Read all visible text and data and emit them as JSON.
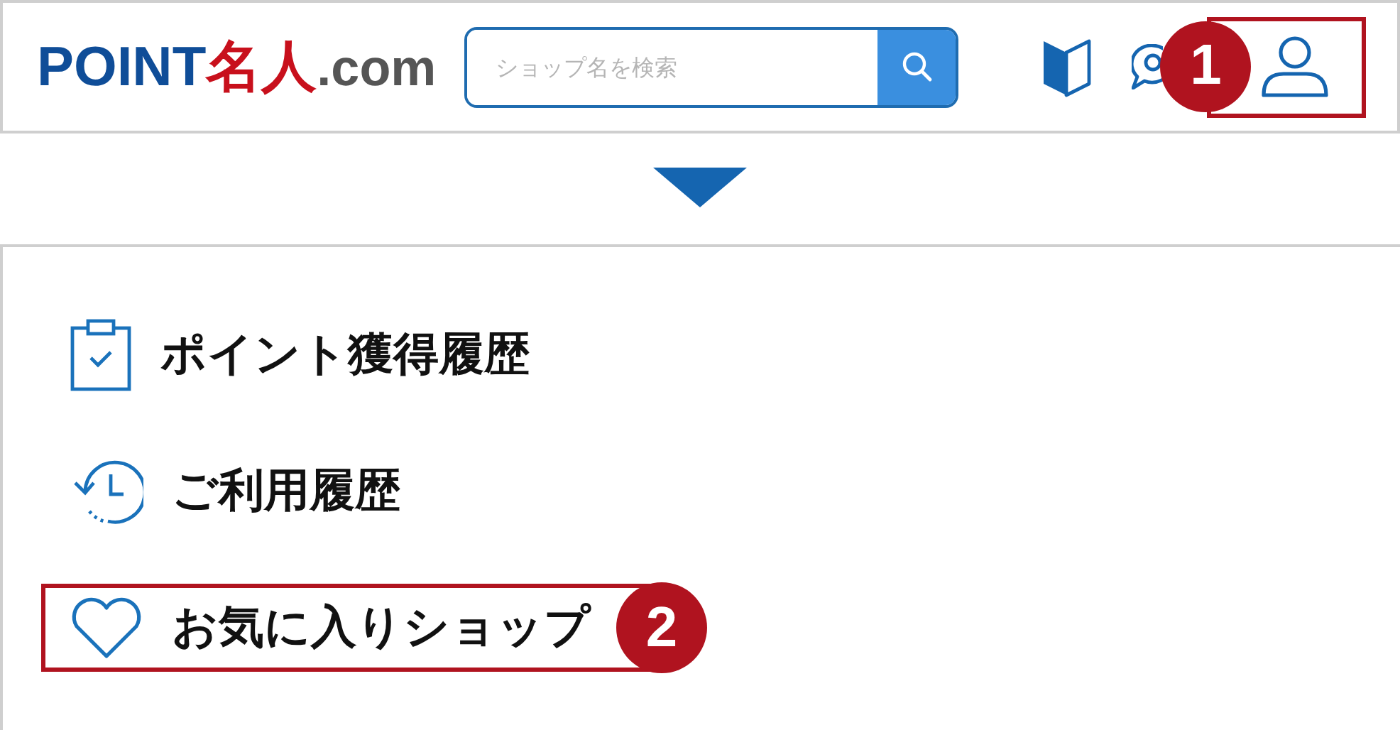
{
  "header": {
    "logo": {
      "point": "POINT",
      "meijin": "名人",
      "dotcom": ".com"
    },
    "search": {
      "placeholder": "ショップ名を検索"
    },
    "icons": [
      {
        "kind": "beginner",
        "highlighted": false
      },
      {
        "kind": "chat",
        "highlighted": false
      },
      {
        "kind": "user",
        "highlighted": true,
        "step": "1"
      }
    ]
  },
  "menu": [
    {
      "kind": "clipboard",
      "label": "ポイント獲得履歴",
      "highlighted": false
    },
    {
      "kind": "history",
      "label": "ご利用履歴",
      "highlighted": false
    },
    {
      "kind": "heart",
      "label": "お気に入りショップ",
      "highlighted": true,
      "step": "2"
    }
  ]
}
